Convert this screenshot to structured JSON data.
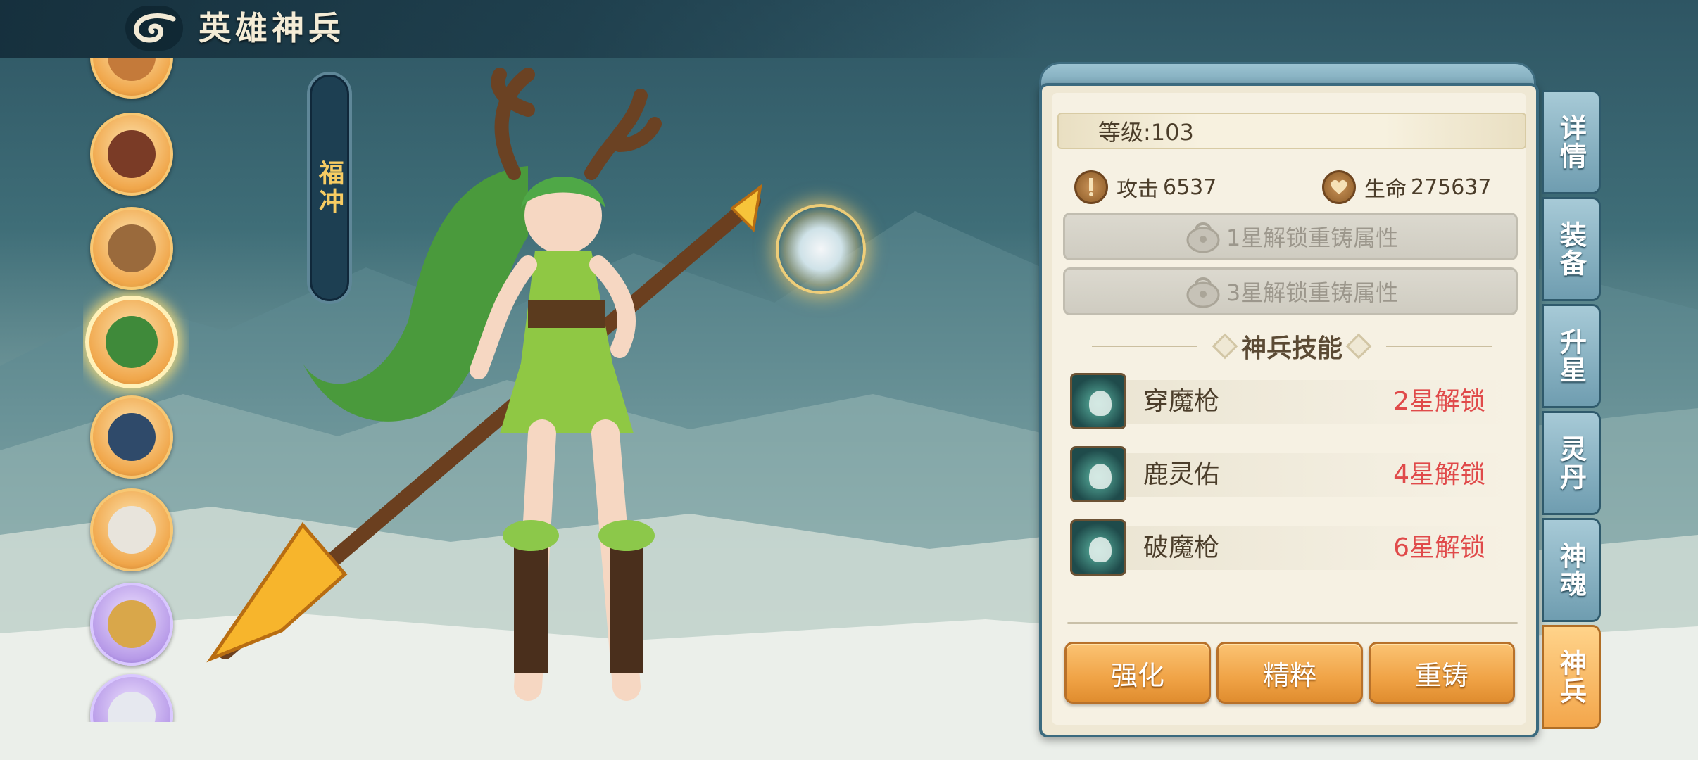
{
  "header": {
    "title": "英雄神兵"
  },
  "hero": {
    "name": "福冲"
  },
  "heroes": [
    {
      "id": "hero-1",
      "frame": "orange"
    },
    {
      "id": "hero-2",
      "frame": "orange"
    },
    {
      "id": "hero-3",
      "frame": "orange"
    },
    {
      "id": "hero-4",
      "frame": "orange",
      "selected": true
    },
    {
      "id": "hero-5",
      "frame": "orange"
    },
    {
      "id": "hero-6",
      "frame": "orange"
    },
    {
      "id": "hero-7",
      "frame": "purple"
    },
    {
      "id": "hero-8",
      "frame": "purple"
    }
  ],
  "panel": {
    "level": "等级:103",
    "attack_label": "攻击",
    "attack_value": "6537",
    "hp_label": "生命",
    "hp_value": "275637",
    "locks": [
      "1星解锁重铸属性",
      "3星解锁重铸属性"
    ],
    "skills_title": "神兵技能",
    "skills": [
      {
        "name": "穿魔枪",
        "unlock": "2星解锁"
      },
      {
        "name": "鹿灵佑",
        "unlock": "4星解锁"
      },
      {
        "name": "破魔枪",
        "unlock": "6星解锁"
      }
    ],
    "buttons": {
      "enhance": "强化",
      "essence": "精粹",
      "reforge": "重铸"
    }
  },
  "tabs": [
    {
      "label": "详情",
      "active": false
    },
    {
      "label": "装备",
      "active": false
    },
    {
      "label": "升星",
      "active": false
    },
    {
      "label": "灵丹",
      "active": false
    },
    {
      "label": "神魂",
      "active": false
    },
    {
      "label": "神兵",
      "active": true
    }
  ],
  "colors": {
    "accent_orange": "#f0a346",
    "lock_red": "#e04a4a",
    "tab_blue": "#6f9db0",
    "panel_bg": "#efe8d4"
  }
}
